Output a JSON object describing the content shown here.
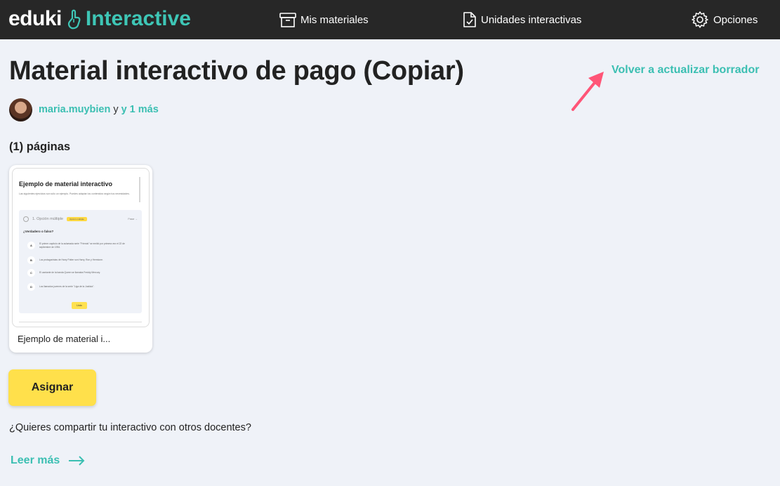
{
  "header": {
    "logo_brand": "eduki",
    "logo_product": "Interactive",
    "nav": [
      {
        "label": "Mis materiales",
        "icon": "archive-box-icon"
      },
      {
        "label": "Unidades interactivas",
        "icon": "document-check-icon"
      },
      {
        "label": "Opciones",
        "icon": "gear-icon"
      }
    ]
  },
  "main": {
    "title": "Material interactivo de pago (Copiar)",
    "update_link": "Volver a actualizar borrador",
    "author": {
      "name": "maria.muybien",
      "conjunction": "y",
      "more": "y 1 más"
    },
    "pages_count": "(1) páginas",
    "pages": [
      {
        "label": "Ejemplo de material i...",
        "preview": {
          "title": "Ejemplo de material interactivo",
          "description": "Las siguientes ejercicios son sólo un ejemplo. Puedes adaptar los contenidos según tus necesidades.",
          "question_type": "1. Opción múltiple",
          "badge": "Opción múltiple",
          "points": "Pasar →",
          "question": "¿Verdadero o falso?",
          "options": [
            {
              "letter": "A",
              "text": "El primer capítulo de la aclamada serie \"Friends\" se emitió por primera vez el 22 de septiembre de 1994."
            },
            {
              "letter": "B",
              "text": "Los protagonistas de Harry Potter son Harry, Ron y Hermione."
            },
            {
              "letter": "C",
              "text": "El cantante de la banda Queen se llamaba Freddy Mercury."
            },
            {
              "letter": "D",
              "text": "Los llamados jovenes de la serie \"Liga de la Justicia\"."
            }
          ],
          "button": "Listo"
        }
      }
    ],
    "assign_button": "Asignar",
    "share_question": "¿Quieres compartir tu interactivo con otros docentes?",
    "read_more": "Leer más"
  },
  "colors": {
    "accent": "#3bbfb2",
    "header_bg": "#272727",
    "button_yellow": "#ffe04b",
    "arrow": "#ff5577"
  }
}
